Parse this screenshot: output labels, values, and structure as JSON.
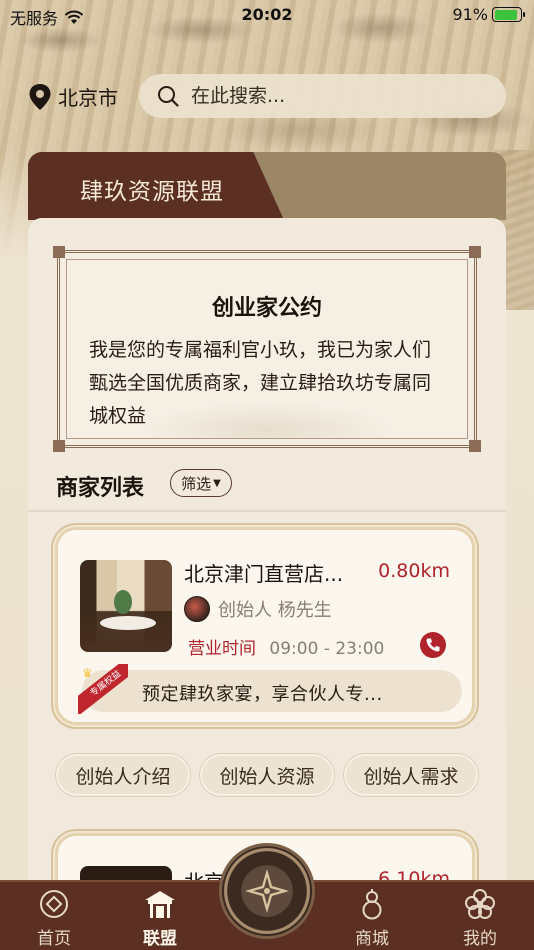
{
  "status_bar": {
    "carrier": "无服务",
    "time": "20:02",
    "battery_percent": "91%",
    "battery_level": 0.91,
    "signal_icon": "wifi-icon",
    "charging_icon": "bolt-icon"
  },
  "location": {
    "city": "北京市",
    "icon": "location-pin-icon"
  },
  "search": {
    "placeholder": "在此搜索...",
    "icon": "search-icon"
  },
  "header_tab": {
    "label": "肆玖资源联盟"
  },
  "charter": {
    "title": "创业家公约",
    "body": "我是您的专属福利官小玖，我已为家人们甄选全国优质商家，建立肆拾玖坊专属同城权益"
  },
  "merchant_list": {
    "title": "商家列表",
    "filter_label": "筛选",
    "merchants": [
      {
        "name": "北京津门直营店...",
        "distance": "0.80km",
        "founder": "创始人 杨先生",
        "hours_label": "营业时间",
        "hours": "09:00 - 23:00",
        "ribbon": "专属权益",
        "promo": "预定肆玖家宴，享合伙人专..."
      },
      {
        "name": "北京...家",
        "distance": "6.10km"
      }
    ]
  },
  "actions": [
    {
      "label": "创始人介绍"
    },
    {
      "label": "创始人资源"
    },
    {
      "label": "创始人需求"
    }
  ],
  "tabbar": {
    "items": [
      {
        "label": "首页",
        "icon": "coin-icon"
      },
      {
        "label": "联盟",
        "icon": "pavilion-icon",
        "active": true
      },
      {
        "label": "商城",
        "icon": "gourd-icon"
      },
      {
        "label": "我的",
        "icon": "flower-icon"
      }
    ],
    "center_icon": "compass-icon"
  },
  "colors": {
    "brand_brown": "#5b2f22",
    "accent_red": "#b0232b",
    "panel_bg": "#f1eadc"
  }
}
